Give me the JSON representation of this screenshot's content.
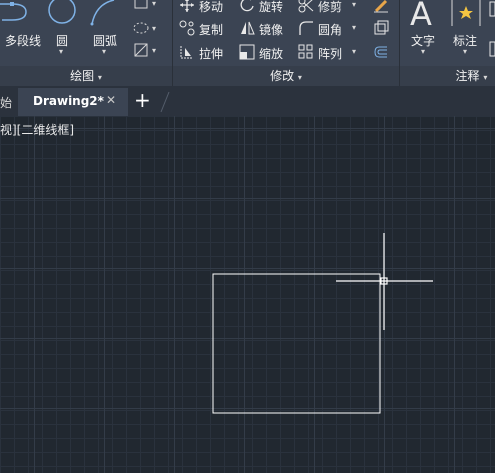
{
  "ribbon": {
    "draw": {
      "polyline_label": "多段线",
      "circle_label": "圆",
      "arc_label": "圆弧",
      "panel_title": "绘图"
    },
    "modify": {
      "move_label": "移动",
      "rotate_label": "旋转",
      "trim_label": "修剪",
      "copy_label": "复制",
      "mirror_label": "镜像",
      "fillet_label": "圆角",
      "stretch_label": "拉伸",
      "scale_label": "缩放",
      "array_label": "阵列",
      "panel_title": "修改"
    },
    "annotation": {
      "text_label": "文字",
      "dimension_label": "标注",
      "panel_title": "注释"
    }
  },
  "tabs": {
    "start_tab_label": "始",
    "active_tab_label": "Drawing2*",
    "close_symbol": "✕",
    "new_tab_symbol": "+"
  },
  "viewport": {
    "label": "视][二维线框]"
  },
  "colors": {
    "ribbon_bg": "#3b4453",
    "canvas_bg": "#212830",
    "geometry": "#ffffff"
  },
  "icons": [
    "polyline-icon",
    "circle-icon",
    "arc-icon",
    "move-icon",
    "rotate-icon",
    "trim-icon",
    "copy-icon",
    "mirror-icon",
    "fillet-icon",
    "stretch-icon",
    "scale-icon",
    "array-icon",
    "text-icon",
    "dimension-icon",
    "crosshair-cursor"
  ]
}
